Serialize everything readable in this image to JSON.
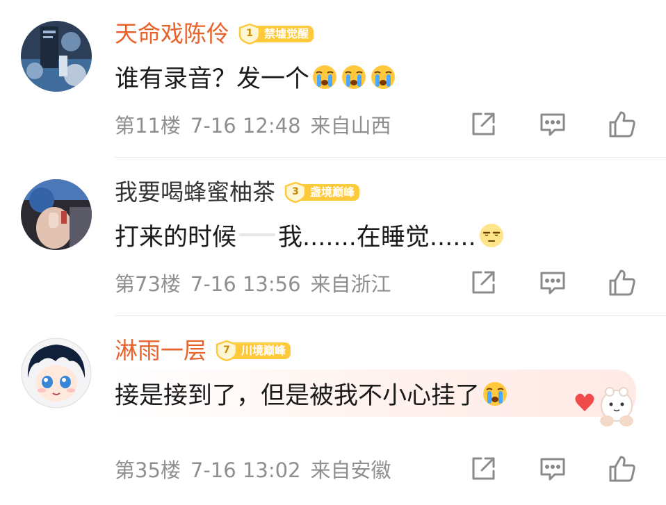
{
  "comments": [
    {
      "username": "天命戏陈伶",
      "name_style": "vip",
      "badge": {
        "level": "1",
        "label": "禁墟觉醒"
      },
      "text_parts": [
        "谁有录音？发一个"
      ],
      "emojis": [
        "crying-emoji",
        "crying-emoji",
        "crying-emoji"
      ],
      "floor": "第11楼",
      "time": "7-16 12:48",
      "location": "来自山西"
    },
    {
      "username": "我要喝蜂蜜柚茶",
      "name_style": "normal",
      "badge": {
        "level": "3",
        "label": "盏境巅峰"
      },
      "text_parts": [
        "打来的时候",
        "我.......在睡觉......"
      ],
      "emojis": [
        "sleepy-emoji"
      ],
      "floor": "第73楼",
      "time": "7-16 13:56",
      "location": "来自浙江"
    },
    {
      "username": "淋雨一层",
      "name_style": "vip",
      "badge": {
        "level": "7",
        "label": "川境巅峰"
      },
      "text_parts": [
        "接是接到了，但是被我不小心挂了"
      ],
      "emojis": [
        "crying-emoji"
      ],
      "floor": "第35楼",
      "time": "7-16 13:02",
      "location": "来自安徽"
    }
  ],
  "actions": [
    "share-icon",
    "reply-icon",
    "like-icon"
  ],
  "colors": {
    "vip_name": "#e8632c",
    "meta_text": "#8f8f8f",
    "badge_fill": "#ffc93c",
    "icon_gray": "#8a8a8a"
  }
}
